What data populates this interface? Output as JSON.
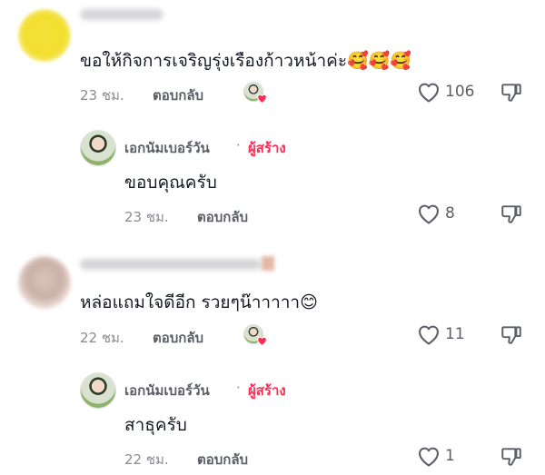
{
  "comments": [
    {
      "text": "ขอให้กิจการเจริญรุ่งเรืองก้าวหน้าค่ะ",
      "emojis": "🥰🥰🥰",
      "time": "23 ชม.",
      "reply_label": "ตอบกลับ",
      "likes": "106",
      "reply": {
        "author": "เอกนัมเบอร์วัน",
        "separator": "·",
        "tag": "ผู้สร้าง",
        "text": "ขอบคุณครับ",
        "time": "23 ชม.",
        "reply_label": "ตอบกลับ",
        "likes": "8"
      }
    },
    {
      "text": "หล่อแถมใจดีอีก รวยๆน๊าาาาา",
      "emojis": "😊",
      "time": "22 ชม.",
      "reply_label": "ตอบกลับ",
      "likes": "11",
      "reply": {
        "author": "เอกนัมเบอร์วัน",
        "separator": "·",
        "tag": "ผู้สร้าง",
        "text": "สาธุครับ",
        "time": "22 ชม.",
        "reply_label": "ตอบกลับ",
        "likes": "1"
      }
    }
  ],
  "colors": {
    "creator_tag": "#fe2c55",
    "secondary_text": "#8a8b91",
    "primary_text": "#161823"
  },
  "icons": [
    "heart-outline-icon",
    "dislike-icon",
    "creator-liked-heart-icon"
  ]
}
